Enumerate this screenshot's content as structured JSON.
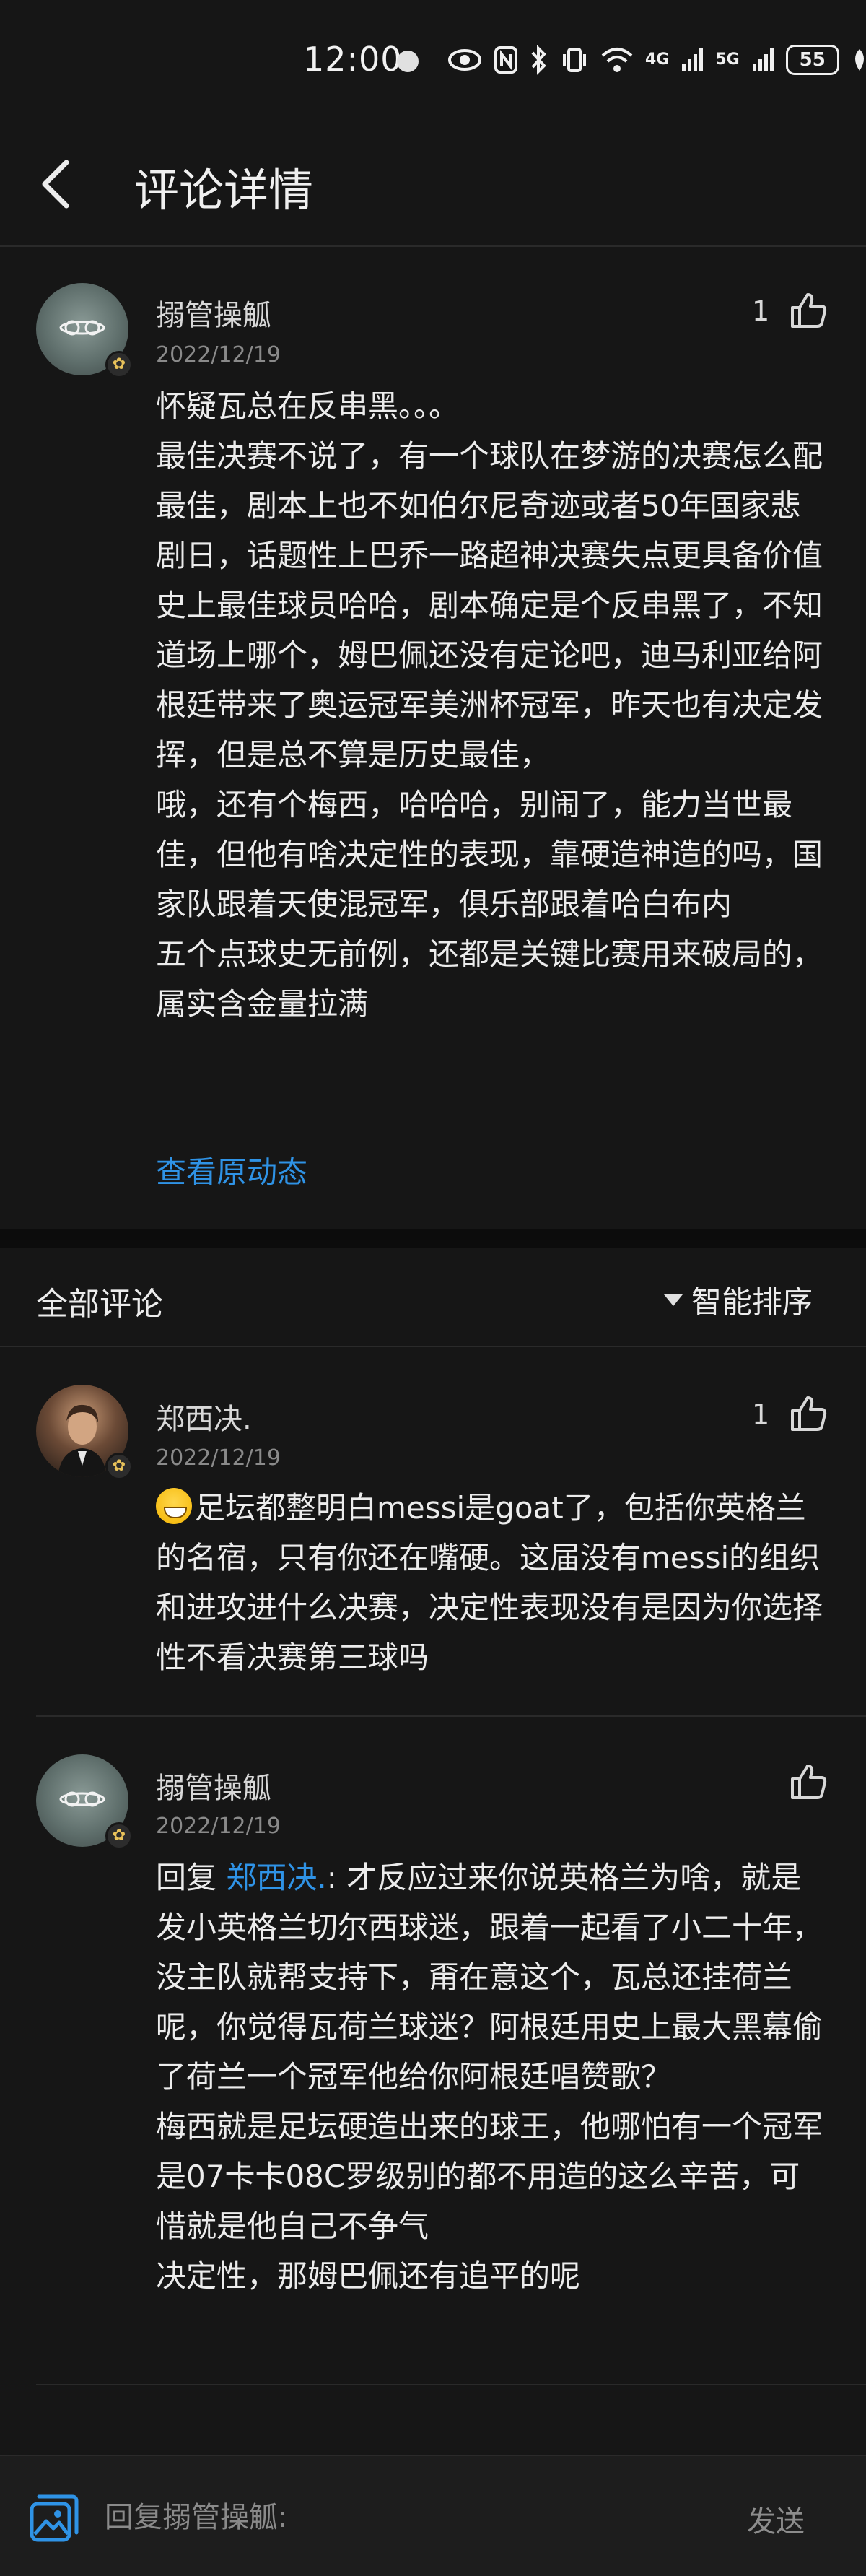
{
  "status_bar": {
    "time": "12:00",
    "icons": [
      "eye-icon",
      "nfc-icon",
      "bluetooth-icon",
      "vibrate-icon",
      "wifi-icon",
      "signal-4g-icon",
      "signal-5g-icon",
      "battery-icon",
      "leaf-icon"
    ],
    "net_4g": "4G",
    "net_5g": "5G",
    "battery": "55"
  },
  "header": {
    "title": "评论详情"
  },
  "main_post": {
    "author": "搦管操觚",
    "date": "2022/12/19",
    "like_count": "1",
    "paragraphs": [
      "怀疑瓦总在反串黑。。。",
      "最佳决赛不说了，有一个球队在梦游的决赛怎么配最佳，剧本上也不如伯尔尼奇迹或者50年国家悲剧日，话题性上巴乔一路超神决赛失点更具备价值",
      "史上最佳球员哈哈，剧本确定是个反串黑了，不知道场上哪个，姆巴佩还没有定论吧，迪马利亚给阿根廷带来了奥运冠军美洲杯冠军，昨天也有决定发挥，但是总不算是历史最佳，",
      "哦，还有个梅西，哈哈哈，别闹了，能力当世最佳，但他有啥决定性的表现，靠硬造神造的吗，国家队跟着天使混冠军，俱乐部跟着哈白布内",
      "五个点球史无前例，还都是关键比赛用来破局的，属实含金量拉满"
    ],
    "view_original": "查看原动态"
  },
  "comments_section": {
    "title": "全部评论",
    "sort_label": "智能排序",
    "comments": [
      {
        "author": "郑西决.",
        "date": "2022/12/19",
        "like_count": "1",
        "text": "足坛都整明白messi是goat了，包括你英格兰的名宿，只有你还在嘴硬。这届没有messi的组织和进攻进什么决赛，决定性表现没有是因为你选择性不看决赛第三球吗"
      },
      {
        "author": "搦管操觚",
        "date": "2022/12/19",
        "reply_prefix": "回复 ",
        "reply_to": "郑西决.",
        "paragraphs": [
          ": 才反应过来你说英格兰为啥，就是发小英格兰切尔西球迷，跟着一起看了小二十年，没主队就帮支持下，甭在意这个，瓦总还挂荷兰呢，你觉得瓦荷兰球迷？阿根廷用史上最大黑幕偷了荷兰一个冠军他给你阿根廷唱赞歌？",
          "梅西就是足坛硬造出来的球王，他哪怕有一个冠军是07卡卡08C罗级别的都不用造的这么辛苦，可惜就是他自己不争气",
          "决定性，那姆巴佩还有追平的呢"
        ]
      }
    ]
  },
  "bottom_bar": {
    "reply_placeholder": "回复搦管操觚:",
    "send_label": "发送"
  },
  "colors": {
    "background": "#161616",
    "link": "#2f93e6",
    "secondary_text": "#8a8a8a"
  }
}
